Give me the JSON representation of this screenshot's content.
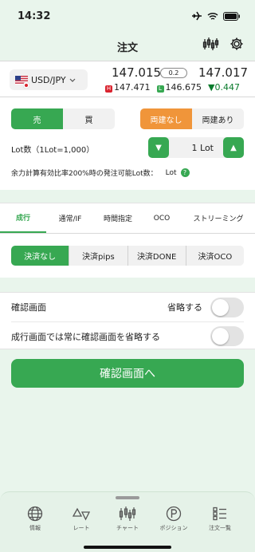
{
  "status_bar": {
    "time": "14:32"
  },
  "header": {
    "title": "注文"
  },
  "rate": {
    "pair": "USD/JPY",
    "bid": "147.015",
    "spread": "0.2",
    "ask": "147.017",
    "high_badge": "H",
    "high": "147.471",
    "low_badge": "L",
    "low": "146.675",
    "change_arrow": "▼",
    "change": "0.447"
  },
  "order": {
    "sell": "売",
    "buy": "買",
    "hedge_off": "両建なし",
    "hedge_on": "両建あり",
    "lot_label": "Lot数（1Lot=1,000）",
    "minus": "▼",
    "lot_value": "1 Lot",
    "plus": "▲",
    "margin_note": "余力計算有効比率200%時の発注可能Lot数：",
    "margin_unit": "Lot",
    "help": "?"
  },
  "tabs": [
    "成行",
    "通常/IF",
    "時間指定",
    "OCO",
    "ストリーミング"
  ],
  "settle": [
    "決済なし",
    "決済pips",
    "決済DONE",
    "決済OCO"
  ],
  "confirm": {
    "row1_label": "確認画面",
    "row1_skip": "省略する",
    "row2_label": "成行画面では常に確認画面を省略する",
    "button": "確認画面へ"
  },
  "bottom_nav": [
    "情報",
    "レート",
    "チャート",
    "ポジション",
    "注文一覧"
  ],
  "colors": {
    "accent": "#37a852",
    "orange": "#f0953a",
    "high": "#d9232e"
  }
}
